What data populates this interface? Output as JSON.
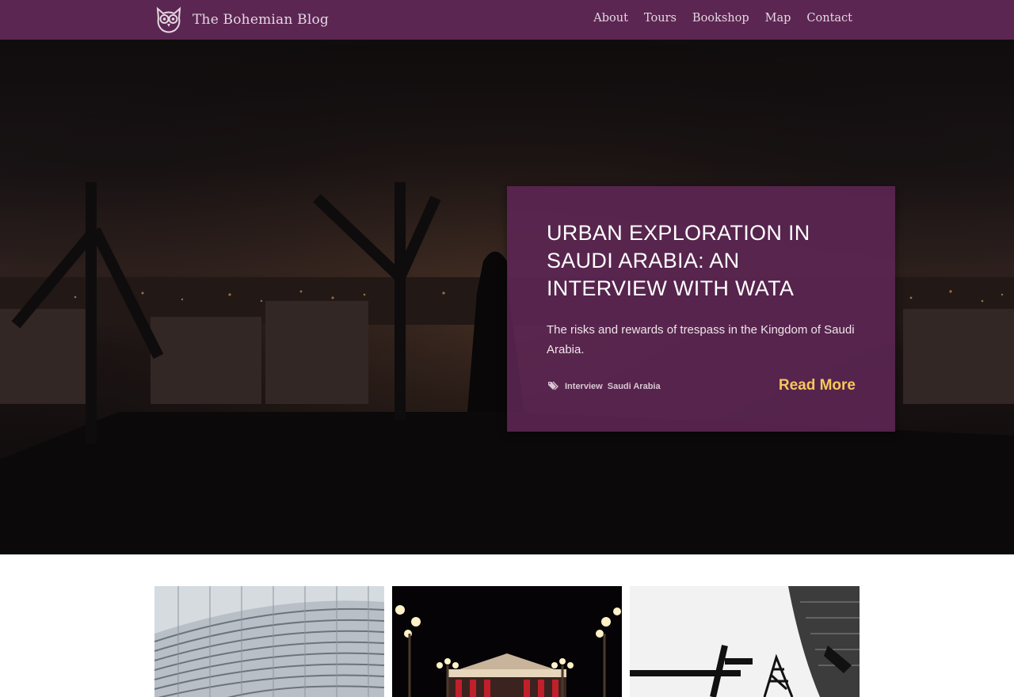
{
  "brand": {
    "name": "The Bohemian Blog",
    "logo_icon": "owl-logo-icon"
  },
  "nav": {
    "items": [
      {
        "label": "About"
      },
      {
        "label": "Tours"
      },
      {
        "label": "Bookshop"
      },
      {
        "label": "Map"
      },
      {
        "label": "Contact"
      }
    ]
  },
  "featured": {
    "title": "Urban Exploration in Saudi Arabia: An Interview with Wata",
    "excerpt": "The risks and rewards of trespass in the Kingdom of Saudi Arabia.",
    "tag_icon": "tags-icon",
    "tags": [
      "Interview",
      "Saudi Arabia"
    ],
    "read_more": "Read More"
  },
  "posts": [
    {
      "image": "curved-apartment-block-photo"
    },
    {
      "image": "illuminated-theatre-night-photo"
    },
    {
      "image": "industrial-structure-silhouette-photo"
    }
  ],
  "colors": {
    "nav_bg": "#5c2653",
    "card_bg": "#5c2653",
    "accent": "#f6c75a",
    "nav_text": "#e4d8e1"
  }
}
